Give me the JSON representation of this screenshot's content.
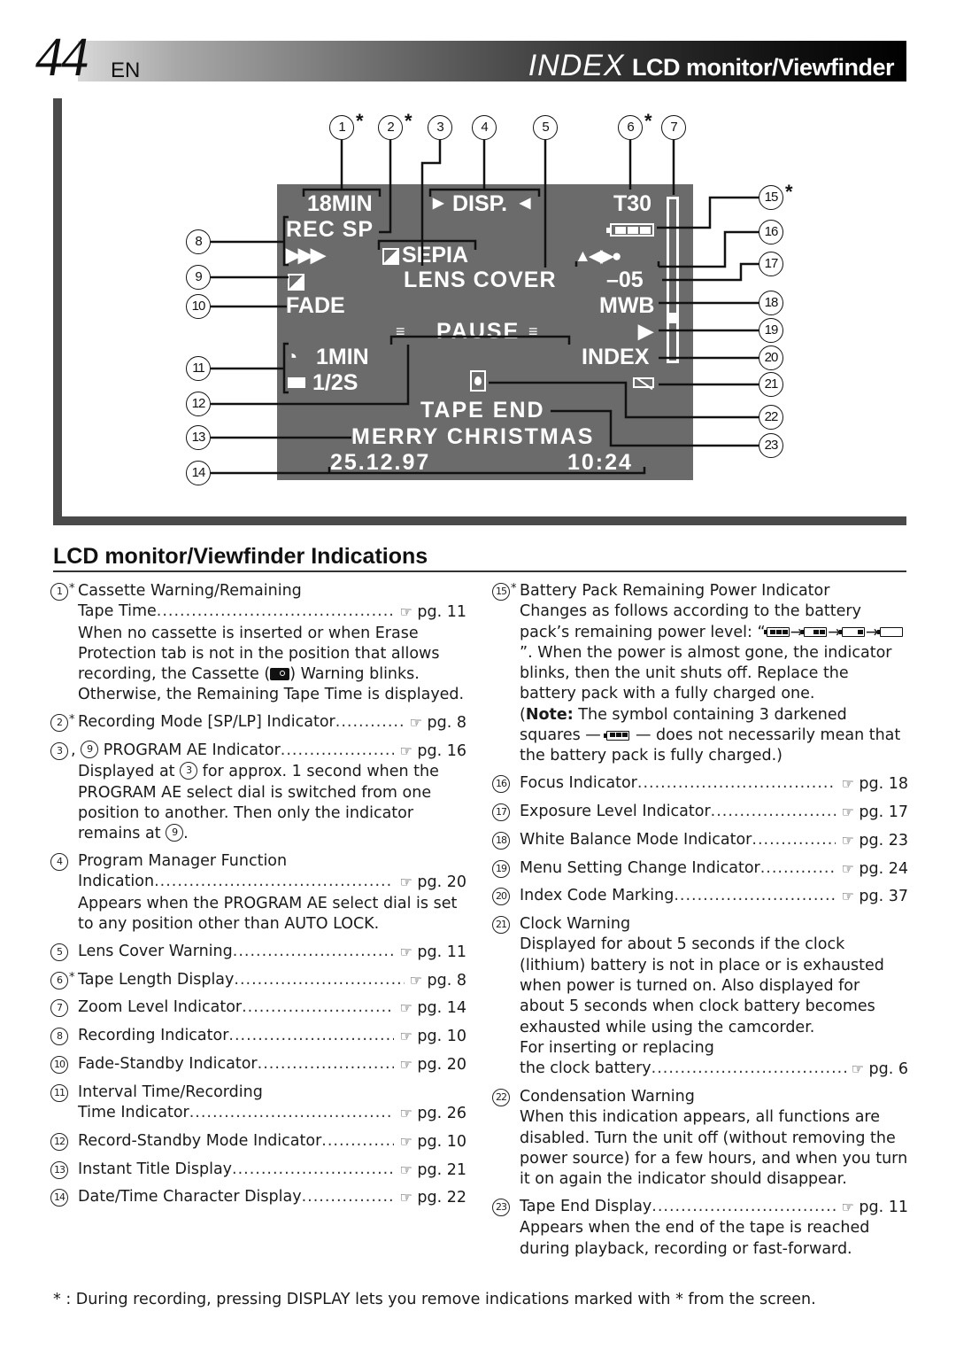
{
  "header": {
    "page_number": "44",
    "language": "EN",
    "title_italic": "INDEX",
    "title_bold": "LCD monitor/Viewfinder"
  },
  "diagram": {
    "lcd": {
      "tape_remaining": "18MIN",
      "rec_mode": "REC SP",
      "rec_indicator": "▶▶▶",
      "program_ae": "SEPIA",
      "program_manager": "DISP.",
      "lens_cover": "LENS COVER",
      "tape_length": "T30",
      "exposure": "–05",
      "white_balance": "MWB",
      "fade": "FADE",
      "pause": "PAUSE",
      "menu_change": "▶",
      "interval": "1MIN",
      "rec_time": "1/2S",
      "index": "INDEX",
      "tape_end": "TAPE END",
      "title": "MERRY CHRISTMAS",
      "date": "25.12.97",
      "time": "10:24"
    },
    "top_callouts": [
      {
        "n": "1",
        "star": true
      },
      {
        "n": "2",
        "star": true
      },
      {
        "n": "3",
        "star": false
      },
      {
        "n": "4",
        "star": false
      },
      {
        "n": "5",
        "star": false
      },
      {
        "n": "6",
        "star": true
      },
      {
        "n": "7",
        "star": false
      }
    ],
    "left_callouts": [
      "8",
      "9",
      "10",
      "11",
      "12",
      "13",
      "14"
    ],
    "right_callouts": [
      {
        "n": "15",
        "star": true
      },
      {
        "n": "16",
        "star": false
      },
      {
        "n": "17",
        "star": false
      },
      {
        "n": "18",
        "star": false
      },
      {
        "n": "19",
        "star": false
      },
      {
        "n": "20",
        "star": false
      },
      {
        "n": "21",
        "star": false
      },
      {
        "n": "22",
        "star": false
      },
      {
        "n": "23",
        "star": false
      }
    ],
    "icons": [
      "tape-icon",
      "sepia-icon",
      "fade-icon",
      "battery-icon",
      "focus-icon",
      "timer-icon",
      "rec-time-icon",
      "condensation-icon",
      "clock-warning-icon",
      "zoom-bar-icon"
    ]
  },
  "section": {
    "title": "LCD monitor/Viewfinder Indications"
  },
  "pointer_glyph": "☞",
  "left_entries": {
    "e1": {
      "n": "1",
      "star": "*",
      "line1": "Cassette Warning/Remaining",
      "label": "Tape Time",
      "ref": "pg. 11",
      "desc_a": "When no cassette is inserted or when Erase Protection tab is not in the position that allows recording, the Cassette (",
      "desc_b": ") Warning blinks. Otherwise, the Remaining Tape Time is displayed."
    },
    "e2": {
      "n": "2",
      "star": "*",
      "label": "Recording Mode [SP/LP] Indicator",
      "ref": "pg. 8"
    },
    "e3": {
      "n": "3",
      "n2": "9",
      "sep": ", ",
      "label": "PROGRAM AE Indicator",
      "ref": "pg. 16",
      "desc_a": "Displayed at ",
      "desc_b": " for approx. 1 second when the PROGRAM AE select dial is switched from one position to another. Then only the indicator remains at ",
      "desc_c": "."
    },
    "e4": {
      "n": "4",
      "line1": "Program Manager Function",
      "label": "Indication",
      "ref": "pg. 20",
      "desc": "Appears when the PROGRAM AE select dial is set to any position other than AUTO LOCK."
    },
    "e5": {
      "n": "5",
      "label": "Lens Cover Warning",
      "ref": "pg. 11"
    },
    "e6": {
      "n": "6",
      "star": "*",
      "label": "Tape Length Display",
      "ref": "pg. 8"
    },
    "e7": {
      "n": "7",
      "label": "Zoom Level Indicator",
      "ref": "pg. 14"
    },
    "e8": {
      "n": "8",
      "label": "Recording Indicator",
      "ref": "pg. 10"
    },
    "e10": {
      "n": "10",
      "label": "Fade-Standby Indicator",
      "ref": "pg. 20"
    },
    "e11": {
      "n": "11",
      "line1": "Interval Time/Recording",
      "label": "Time Indicator",
      "ref": "pg. 26"
    },
    "e12": {
      "n": "12",
      "label": "Record-Standby Mode Indicator",
      "ref": "pg. 10"
    },
    "e13": {
      "n": "13",
      "label": "Instant Title Display",
      "ref": "pg. 21"
    },
    "e14": {
      "n": "14",
      "label": "Date/Time Character Display",
      "ref": "pg. 22"
    }
  },
  "right_entries": {
    "e15": {
      "n": "15",
      "star": "*",
      "line1": "Battery Pack Remaining Power Indicator",
      "desc_a": "Changes as follows according to the battery pack’s remaining power level: “",
      "desc_b": "”. When the power is almost gone, the indicator blinks, then the unit shuts off. Replace the battery pack with a fully charged one.",
      "note_open": "(",
      "note_label": "Note:",
      "note_a": " The symbol containing 3 darkened squares — ",
      "note_b": " — does not necessarily mean that the battery pack is fully charged.)",
      "battery_levels": [
        3,
        2,
        1,
        0
      ]
    },
    "e16": {
      "n": "16",
      "label": "Focus Indicator",
      "ref": "pg. 18"
    },
    "e17": {
      "n": "17",
      "label": "Exposure Level Indicator",
      "ref": "pg. 17"
    },
    "e18": {
      "n": "18",
      "label": "White Balance Mode Indicator",
      "ref": "pg. 23"
    },
    "e19": {
      "n": "19",
      "label": "Menu Setting Change Indicator",
      "ref": "pg. 24"
    },
    "e20": {
      "n": "20",
      "label": "Index Code Marking",
      "ref": "pg. 37"
    },
    "e21": {
      "n": "21",
      "line1": "Clock Warning",
      "desc": "Displayed for about 5 seconds if the clock (lithium) battery is not in place or is exhausted when power is turned on. Also displayed for about 5 seconds when clock battery becomes exhausted while using the camcorder.",
      "line_pre": "For inserting or replacing",
      "label": "the clock battery",
      "ref": "pg. 6"
    },
    "e22": {
      "n": "22",
      "line1": "Condensation Warning",
      "desc": "When this indication appears, all functions are disabled. Turn the unit off (without removing the power source) for a few hours, and when you turn it on again the indicator should disappear."
    },
    "e23": {
      "n": "23",
      "label": "Tape End Display",
      "ref": "pg. 11",
      "desc": "Appears when the end of the tape is reached during playback, recording or fast-forward."
    }
  },
  "footnote": "* : During recording, pressing DISPLAY lets you remove indications marked with * from the screen."
}
